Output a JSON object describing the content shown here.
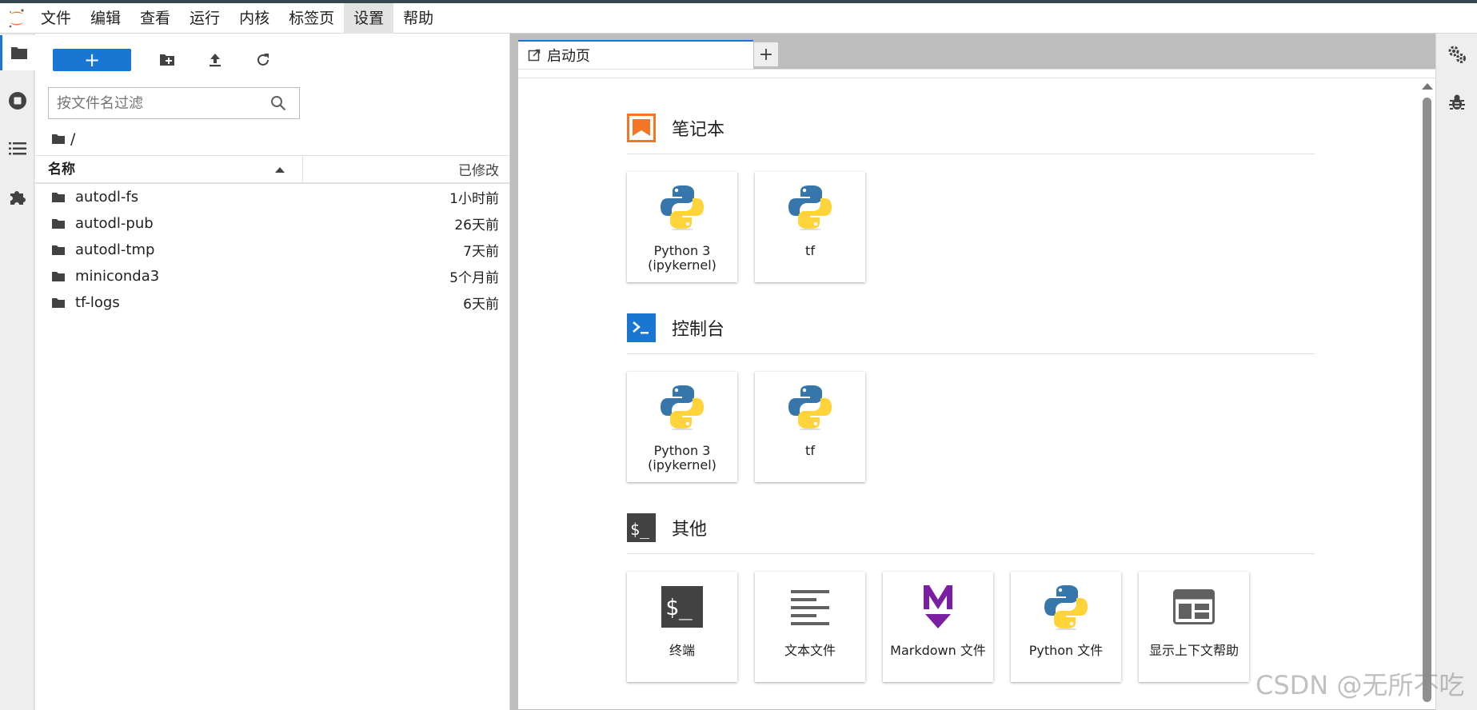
{
  "menu": {
    "items": [
      "文件",
      "编辑",
      "查看",
      "运行",
      "内核",
      "标签页",
      "设置",
      "帮助"
    ],
    "active_index": 6
  },
  "file_browser": {
    "new_button_label": "+",
    "filter_placeholder": "按文件名过滤",
    "breadcrumb": "/",
    "columns": {
      "name": "名称",
      "modified": "已修改"
    },
    "files": [
      {
        "name": "autodl-fs",
        "modified": "1小时前"
      },
      {
        "name": "autodl-pub",
        "modified": "26天前"
      },
      {
        "name": "autodl-tmp",
        "modified": "7天前"
      },
      {
        "name": "miniconda3",
        "modified": "5个月前"
      },
      {
        "name": "tf-logs",
        "modified": "6天前"
      }
    ]
  },
  "tabs": {
    "launcher_label": "启动页",
    "add_label": "+"
  },
  "launcher": {
    "notebook": {
      "title": "笔记本",
      "cards": [
        {
          "label": "Python 3\n(ipykernel)",
          "icon": "python-icon"
        },
        {
          "label": "tf",
          "icon": "python-icon"
        }
      ]
    },
    "console": {
      "title": "控制台",
      "cards": [
        {
          "label": "Python 3\n(ipykernel)",
          "icon": "python-icon"
        },
        {
          "label": "tf",
          "icon": "python-icon"
        }
      ]
    },
    "other": {
      "title": "其他",
      "cards": [
        {
          "label": "终端",
          "icon": "terminal-icon"
        },
        {
          "label": "文本文件",
          "icon": "text-file-icon"
        },
        {
          "label": "Markdown 文件",
          "icon": "markdown-icon"
        },
        {
          "label": "Python 文件",
          "icon": "python-icon"
        },
        {
          "label": "显示上下文帮助",
          "icon": "context-help-icon"
        }
      ]
    }
  },
  "watermark": "CSDN @无所不吃",
  "colors": {
    "accent": "#1976d2",
    "notebook_orange": "#f37626",
    "markdown_purple": "#7b1fa2",
    "python_blue": "#3776ab",
    "python_yellow": "#ffd43b"
  }
}
